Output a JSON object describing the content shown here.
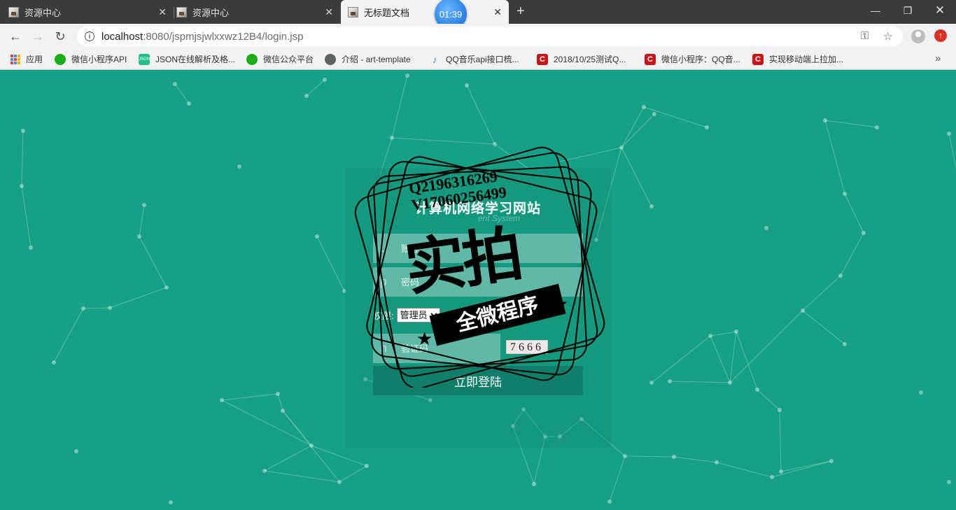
{
  "browser": {
    "tabs": [
      {
        "title": "资源中心",
        "active": false
      },
      {
        "title": "资源中心",
        "active": false
      },
      {
        "title": "无标题文档",
        "active": true
      }
    ],
    "timer": "01:39",
    "url_host": "localhost",
    "url_rest": ":8080/jspmjsjwlxxwz12B4/login.jsp",
    "bookmarks": [
      {
        "label": "应用",
        "icon": "apps-icon"
      },
      {
        "label": "微信小程序API",
        "icon": "wechat-icon"
      },
      {
        "label": "JSON在线解析及格...",
        "icon": "json-icon"
      },
      {
        "label": "微信公众平台",
        "icon": "wechat-icon"
      },
      {
        "label": "介绍 - art-template",
        "icon": "globe-icon"
      },
      {
        "label": "QQ音乐api接口梳...",
        "icon": "qq-music-icon"
      },
      {
        "label": "2018/10/25测试Q...",
        "icon": "csdn-icon"
      },
      {
        "label": "微信小程序：QQ音...",
        "icon": "csdn-icon"
      },
      {
        "label": "实现移动端上拉加...",
        "icon": "csdn-icon"
      }
    ]
  },
  "login": {
    "title": "计算机网络学习网站",
    "subtitle": "ent System",
    "username_icon": "u",
    "username_placeholder": "账号",
    "password_icon": "p",
    "password_placeholder": "密码",
    "role_label": "权限:",
    "role_value": "管理员",
    "captcha_icon": "n",
    "captcha_placeholder": "验证码",
    "captcha_code": "7666",
    "submit_label": "立即登陆"
  },
  "watermark": {
    "qq": "Q2196316269",
    "v": "V17060256499",
    "big": "实拍",
    "ribbon": "全微程序"
  },
  "colors": {
    "page_bg": "#16a085",
    "button_bg": "#0f7f69"
  }
}
